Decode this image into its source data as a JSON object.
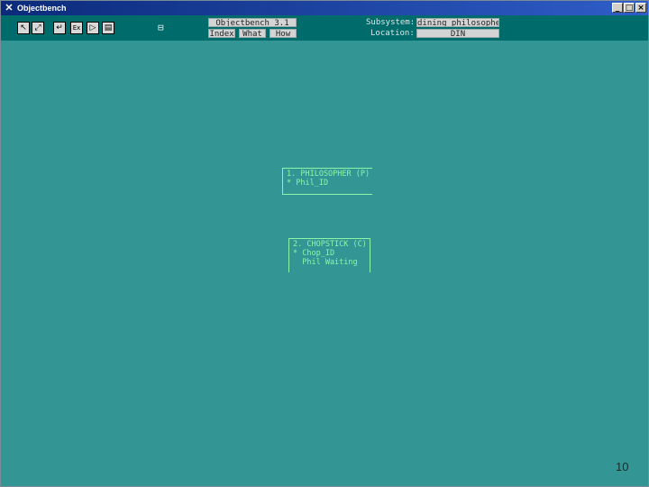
{
  "window": {
    "title": "Objectbench"
  },
  "titlebar": {
    "minimize": "_",
    "maximize": "□",
    "close": "×"
  },
  "toolbar": {
    "tools": [
      {
        "name": "select-tool-icon",
        "glyph": "↖"
      },
      {
        "name": "resize-tool-icon",
        "glyph": "⤢"
      },
      {
        "name": "return-tool-icon",
        "glyph": "↵"
      },
      {
        "name": "exit-tool-icon",
        "glyph": "Ex"
      },
      {
        "name": "run-tool-icon",
        "glyph": "▷"
      },
      {
        "name": "save-tool-icon",
        "glyph": "▤"
      }
    ],
    "lock_glyph": "⊟",
    "app_button": "Objectbench 3.1",
    "index_button": "Index",
    "what_button": "What",
    "how_button": "How",
    "subsystem_label": "Subsystem:",
    "subsystem_value": "dining_philosophers",
    "location_label": "Location:",
    "location_value": "DIN"
  },
  "canvas": {
    "nodes": [
      {
        "lines": [
          "1. PHILOSOPHER (P)",
          "* Phil_ID"
        ]
      },
      {
        "lines": [
          "2. CHOPSTICK (C)",
          "* Chop_ID",
          "  Phil Waiting"
        ]
      }
    ]
  },
  "page_number": "10"
}
